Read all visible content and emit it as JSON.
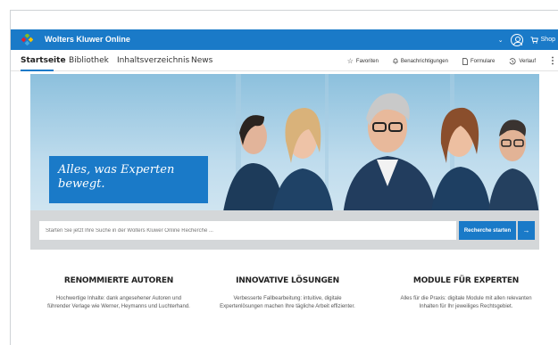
{
  "topbar": {
    "brand": "Wolters Kluwer Online",
    "shop_label": "Shop",
    "colors": {
      "topbar": "#1a7ac8",
      "accent": "#1a7ac8"
    }
  },
  "nav": {
    "tabs": [
      {
        "label": "Startseite",
        "active": true
      },
      {
        "label": "Bibliothek",
        "active": false
      },
      {
        "label": "Inhaltsverzeichnis",
        "active": false
      },
      {
        "label": "News",
        "active": false
      }
    ],
    "actions": [
      {
        "icon": "star-icon",
        "label": "Favoriten"
      },
      {
        "icon": "bell-icon",
        "label": "Benachrichtigungen"
      },
      {
        "icon": "document-icon",
        "label": "Formulare"
      },
      {
        "icon": "history-icon",
        "label": "Verlauf"
      }
    ]
  },
  "hero": {
    "headline": "Alles, was Experten bewegt."
  },
  "search": {
    "placeholder": "Starten Sie jetzt Ihre Suche in der Wolters Kluwer Online Recherche ...",
    "button_label": "Recherche starten",
    "arrow": "→"
  },
  "features": [
    {
      "title": "RENOMMIERTE AUTOREN",
      "text": "Hochwertige Inhalte: dank angesehener Autoren und führender Verlage wie Werner, Heymanns und Luchterhand."
    },
    {
      "title": "INNOVATIVE LÖSUNGEN",
      "text": "Verbesserte Fallbearbeitung: intuitive, digitale Expertenlösungen machen Ihre tägliche Arbeit effizienter."
    },
    {
      "title": "MODULE FÜR EXPERTEN",
      "text": "Alles für die Praxis: digitale Module mit allen relevanten Inhalten für Ihr jeweiliges Rechtsgebiet."
    }
  ]
}
